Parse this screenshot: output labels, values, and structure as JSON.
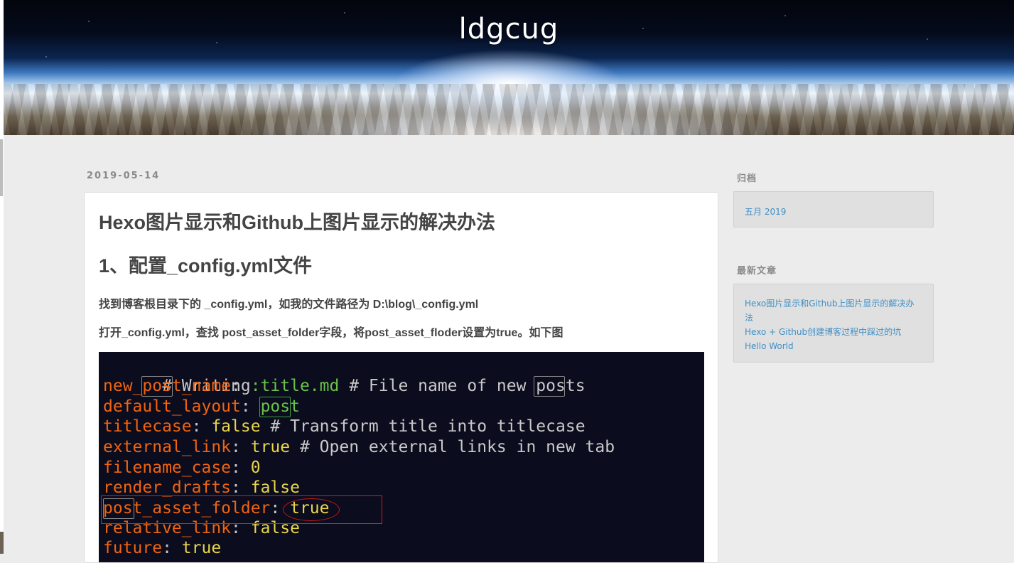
{
  "header": {
    "site_title": "ldgcug"
  },
  "post": {
    "date": "2019-05-14",
    "title": "Hexo图片显示和Github上图片显示的解决办法",
    "section_heading": "1、配置_config.yml文件",
    "paragraph_1": "找到博客根目录下的 _config.yml，如我的文件路径为 D:\\blog\\_config.yml",
    "paragraph_2": "打开_config.yml，查找 post_asset_folder字段，将post_asset_floder设置为true。如下图",
    "code_image": {
      "comment": "# Writing",
      "lines": [
        {
          "key": "new_post_name",
          "value": ":title.md",
          "comment": "# File name of new posts"
        },
        {
          "key": "default_layout",
          "value": "post",
          "comment": ""
        },
        {
          "key": "titlecase",
          "value": "false",
          "comment": "# Transform title into titlecase"
        },
        {
          "key": "external_link",
          "value": "true",
          "comment": "# Open external links in new tab"
        },
        {
          "key": "filename_case",
          "value": "0",
          "comment": ""
        },
        {
          "key": "render_drafts",
          "value": "false",
          "comment": ""
        },
        {
          "key": "post_asset_folder",
          "value": "true",
          "comment": ""
        },
        {
          "key": "relative_link",
          "value": "false",
          "comment": ""
        },
        {
          "key": "future",
          "value": "true",
          "comment": ""
        }
      ]
    }
  },
  "sidebar": {
    "archive_heading": "归档",
    "archive_items": [
      "五月 2019"
    ],
    "recent_heading": "最新文章",
    "recent_items": [
      "Hexo图片显示和Github上图片显示的解决办法",
      "Hexo + Github创建博客过程中踩过的坑",
      "Hello World"
    ]
  },
  "colors": {
    "background": "#ececec",
    "link": "#3e8fc6",
    "code_key": "#f0640f",
    "code_value": "#e8d64a",
    "code_string": "#6ac24a",
    "highlight_red": "#d02020"
  }
}
